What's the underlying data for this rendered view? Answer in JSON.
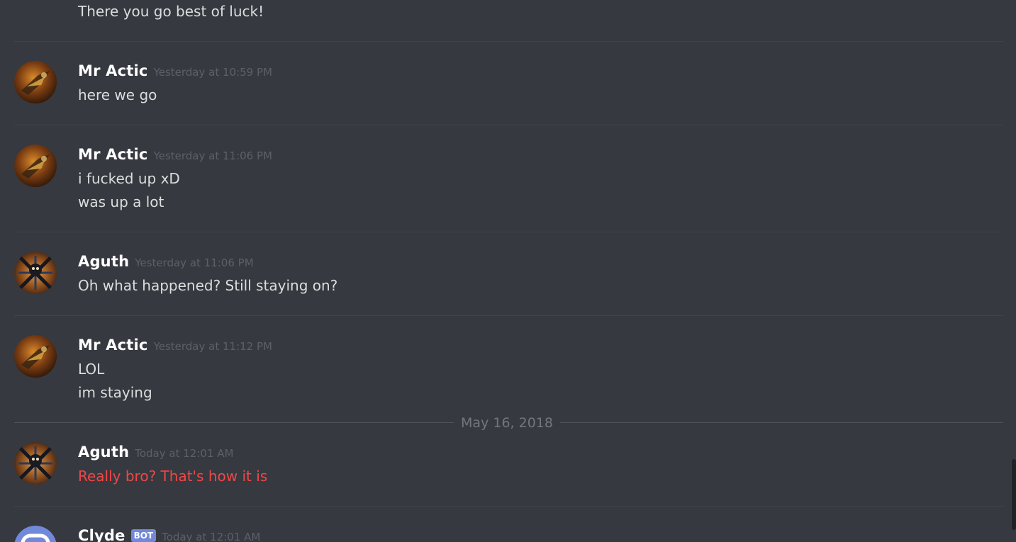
{
  "messages": [
    {
      "author": "",
      "time": "",
      "lines": [
        "There you go best of luck!"
      ]
    },
    {
      "author": "Mr Actic",
      "time": "Yesterday at 10:59 PM",
      "lines": [
        "here we go"
      ]
    },
    {
      "author": "Mr Actic",
      "time": "Yesterday at 11:06 PM",
      "lines": [
        "i fucked up xD",
        "was up a lot"
      ]
    },
    {
      "author": "Aguth",
      "time": "Yesterday at 11:06 PM",
      "lines": [
        "Oh what happened? Still staying on?"
      ]
    },
    {
      "author": "Mr Actic",
      "time": "Yesterday at 11:12 PM",
      "lines": [
        "LOL",
        "im staying"
      ]
    },
    {
      "author": "Aguth",
      "time": "Today at 12:01 AM",
      "lines": [
        "Really bro? That's how it is"
      ],
      "text_color": "#f04747"
    },
    {
      "author": "Clyde",
      "badge": "BOT",
      "time": "Today at 12:01 AM",
      "lines": []
    }
  ],
  "date_separator": "May 16, 2018",
  "colors": {
    "background": "#36393f",
    "author": "#ffffff",
    "timestamp": "#5d6067",
    "message_text": "#dcddde",
    "error_text": "#f04747",
    "bot_badge": "#7289da",
    "divider": "#40434a"
  },
  "icons": {
    "mr_actic_avatar": "avatar-mr-actic",
    "aguth_avatar": "avatar-aguth",
    "clyde_avatar": "clyde-bot-avatar"
  }
}
